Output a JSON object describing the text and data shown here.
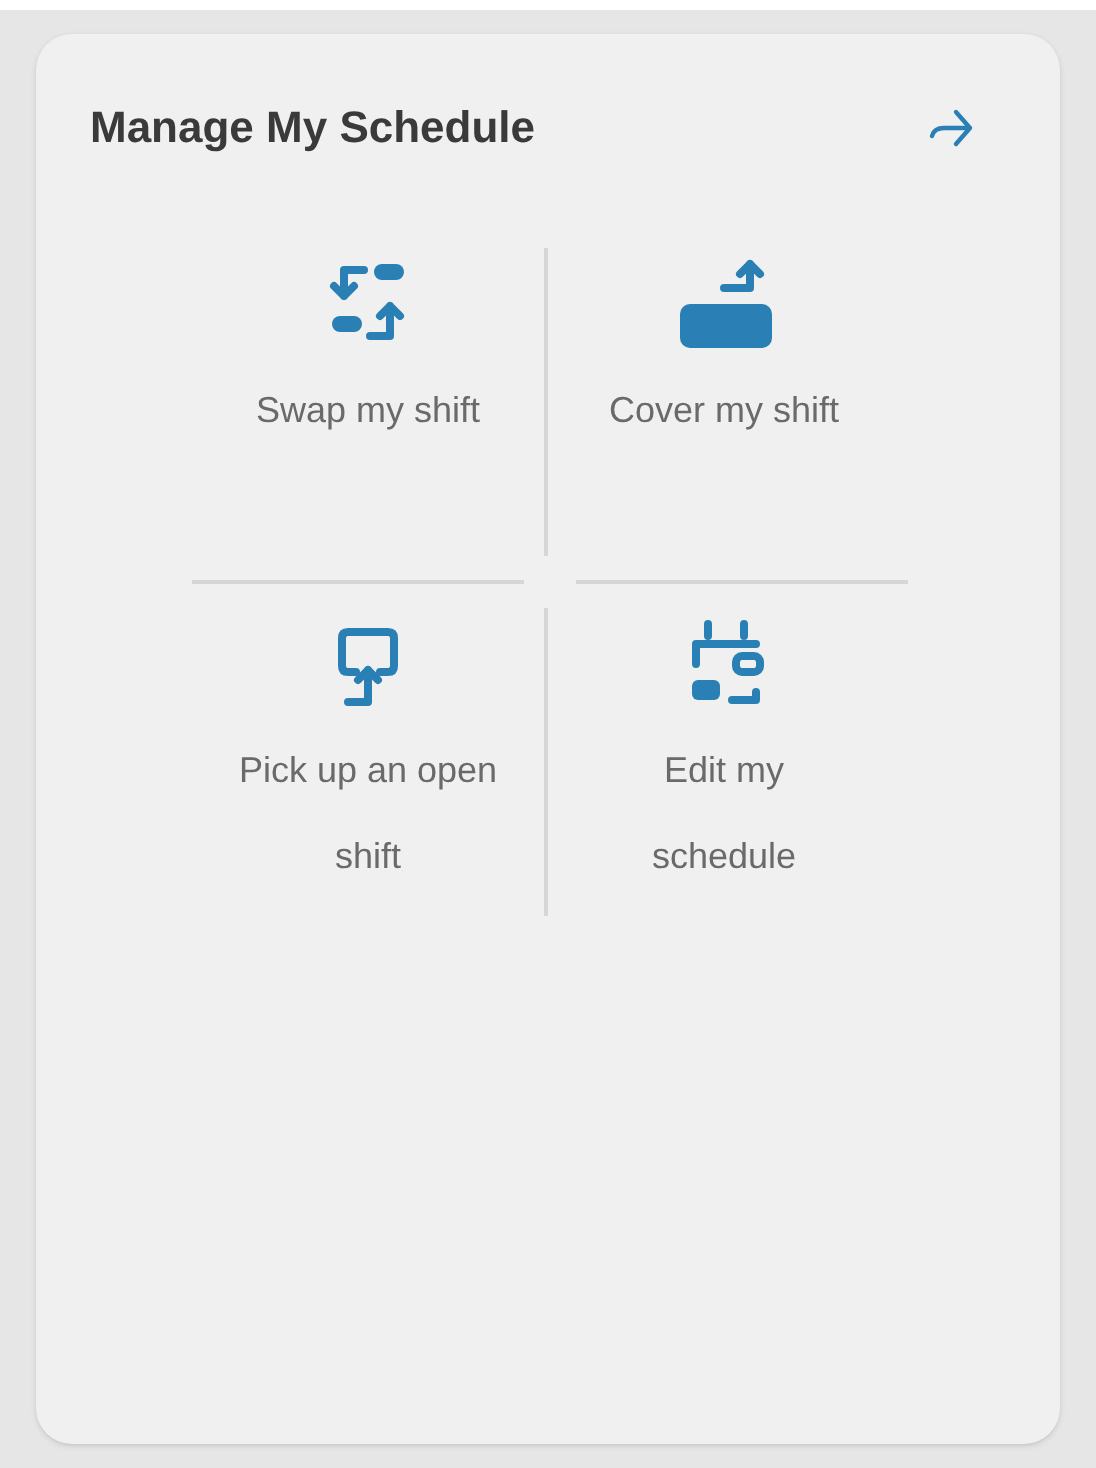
{
  "card": {
    "title": "Manage My Schedule"
  },
  "actions": [
    {
      "kind": "swap",
      "label": "Swap my shift"
    },
    {
      "kind": "cover",
      "label": "Cover my shift"
    },
    {
      "kind": "pickup",
      "label": "Pick up an open shift"
    },
    {
      "kind": "edit",
      "label": "Edit my schedule"
    }
  ]
}
